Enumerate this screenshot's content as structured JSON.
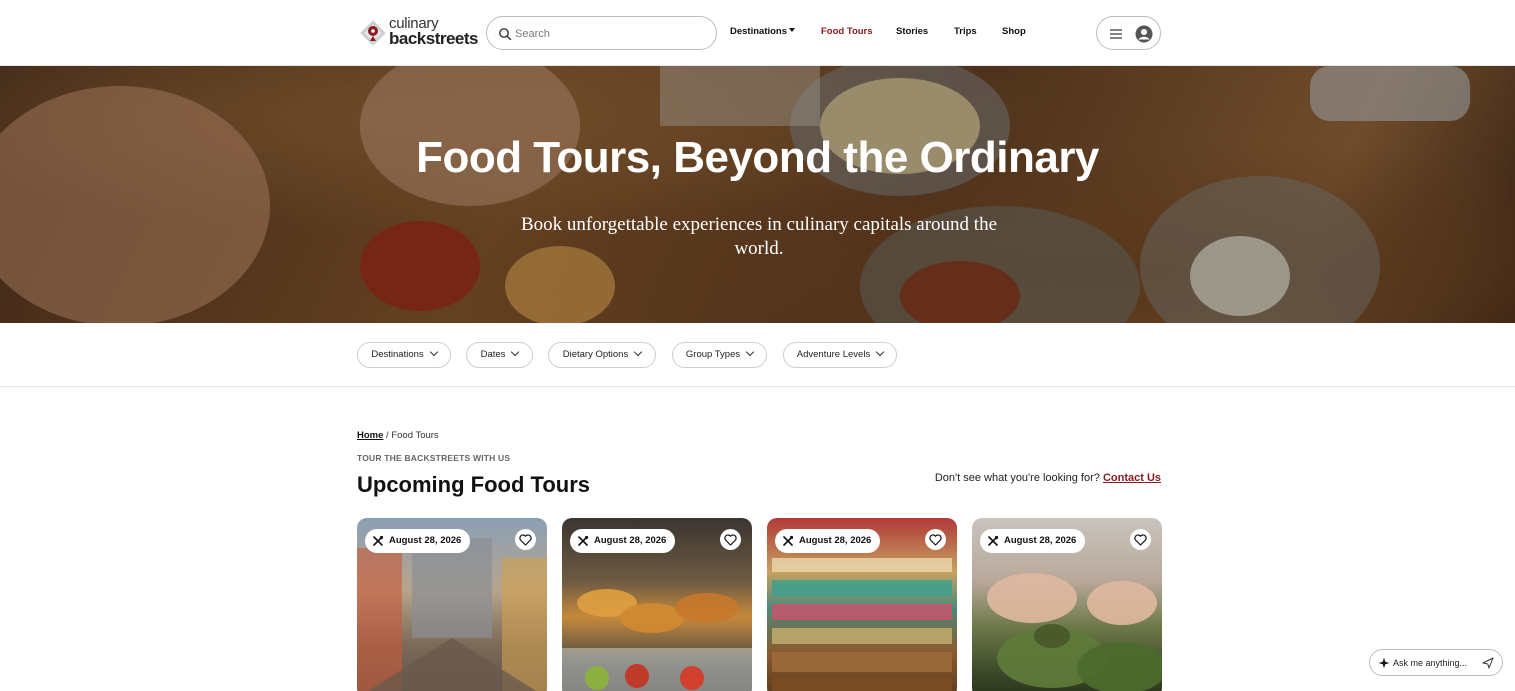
{
  "header": {
    "logo": {
      "line1": "culinary",
      "line2": "backstreets"
    },
    "search": {
      "placeholder": "Search"
    },
    "nav": [
      {
        "label": "Destinations",
        "has_dropdown": true,
        "active": false
      },
      {
        "label": "Food Tours",
        "active": true
      },
      {
        "label": "Stories",
        "active": false
      },
      {
        "label": "Trips",
        "active": false
      },
      {
        "label": "Shop",
        "active": false
      }
    ],
    "icons": {
      "search": "search-icon",
      "menu": "hamburger-menu-icon",
      "account": "user-account-icon"
    }
  },
  "hero": {
    "title": "Food Tours, Beyond the Ordinary",
    "subtitle": "Book unforgettable experiences in culinary capitals around the world."
  },
  "filters": [
    {
      "label": "Destinations"
    },
    {
      "label": "Dates"
    },
    {
      "label": "Dietary Options"
    },
    {
      "label": "Group Types"
    },
    {
      "label": "Adventure Levels"
    }
  ],
  "breadcrumb": {
    "home": "Home",
    "separator": "/",
    "current": "Food Tours"
  },
  "section": {
    "eyebrow": "TOUR THE BACKSTREETS WITH US",
    "title": "Upcoming Food Tours",
    "contact_prompt": "Don't see what you're looking for?",
    "contact_link": "Contact Us"
  },
  "cards": [
    {
      "date": "August 28, 2026"
    },
    {
      "date": "August 28, 2026"
    },
    {
      "date": "August 28, 2026"
    },
    {
      "date": "August 28, 2026"
    }
  ],
  "chat": {
    "placeholder": "Ask me anything..."
  },
  "colors": {
    "brand": "#8a1c22",
    "text": "#111111",
    "border": "#bdbdbd"
  }
}
